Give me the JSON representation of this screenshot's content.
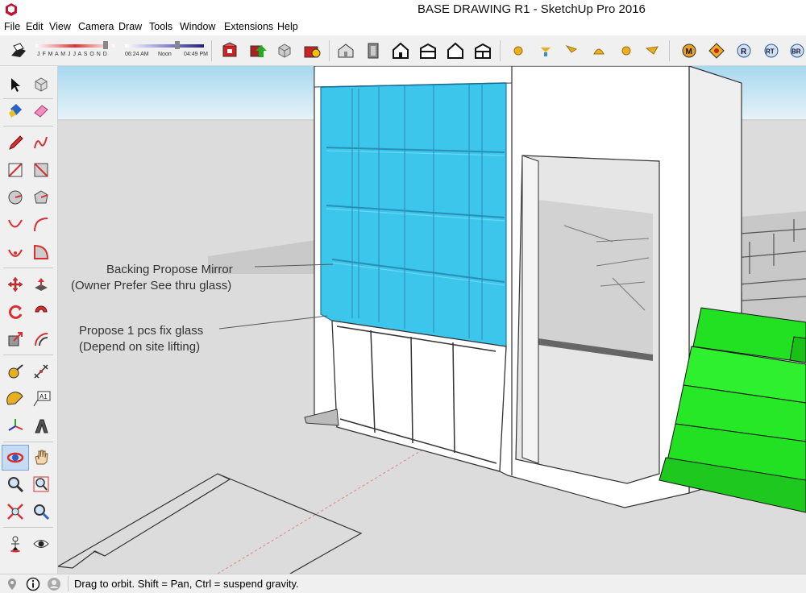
{
  "window": {
    "title": "BASE DRAWING R1 - SketchUp Pro 2016"
  },
  "menu": [
    {
      "label": "File"
    },
    {
      "label": "Edit"
    },
    {
      "label": "View"
    },
    {
      "label": "Camera"
    },
    {
      "label": "Draw"
    },
    {
      "label": "Tools"
    },
    {
      "label": "Window"
    },
    {
      "label": "Extensions"
    },
    {
      "label": "Help"
    }
  ],
  "shadows": {
    "months": "J F M A M J J A S O N D",
    "time_start": "06:24 AM",
    "time_mid": "Noon",
    "time_end": "04:49 PM"
  },
  "plugins": {
    "m": "M",
    "r": "R",
    "rt": "RT",
    "br": "BR"
  },
  "annotations": {
    "mirror_line1": "Backing Propose Mirror",
    "mirror_line2": "(Owner Prefer See thru glass)",
    "glass_line1": "Propose 1 pcs fix glass",
    "glass_line2": "(Depend on site lifting)"
  },
  "text_tool_label": "A1",
  "status": {
    "text": "Drag to orbit. Shift = Pan, Ctrl = suspend gravity."
  },
  "colors": {
    "glass": "#3cc6ec",
    "stairs": "#22e022",
    "ground": "#dcdcdc",
    "sky": "#aadcf0"
  }
}
